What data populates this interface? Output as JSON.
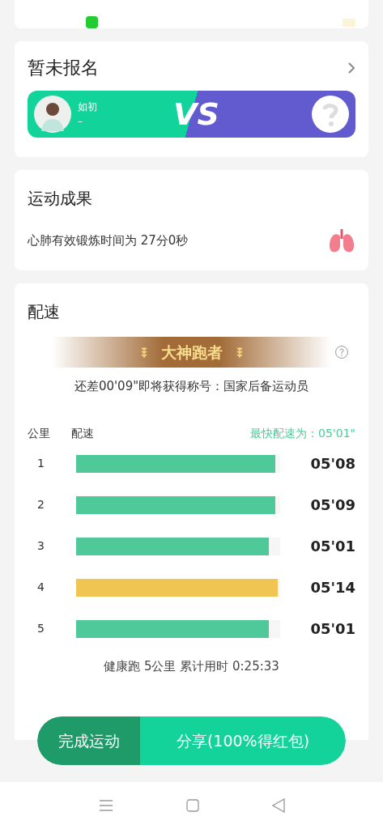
{
  "signup": {
    "title": "暂未报名",
    "player_name": "如初",
    "player_score": "–",
    "vs_label": "VS"
  },
  "result": {
    "title": "运动成果",
    "text": "心肺有效锻炼时间为 27分0秒"
  },
  "pace": {
    "title": "配速",
    "badge": "大神跑者",
    "hint": "还差00'09\"即将获得称号：国家后备运动员",
    "col_km": "公里",
    "col_pace": "配速",
    "fastest": "最快配速为：05'01\"",
    "rows": [
      {
        "km": "1",
        "level": 0.976,
        "time": "05'08",
        "color": "#4fc99a"
      },
      {
        "km": "2",
        "level": 0.976,
        "time": "05'09",
        "color": "#4fc99a"
      },
      {
        "km": "3",
        "level": 0.945,
        "time": "05'01",
        "color": "#4fc99a"
      },
      {
        "km": "4",
        "level": 0.99,
        "time": "05'14",
        "color": "#f0c552"
      },
      {
        "km": "5",
        "level": 0.945,
        "time": "05'01",
        "color": "#4fc99a"
      }
    ],
    "summary": "健康跑 5公里 累计用时 0:25:33"
  },
  "actions": {
    "finish": "完成运动",
    "share": "分享(100%得红包)"
  }
}
